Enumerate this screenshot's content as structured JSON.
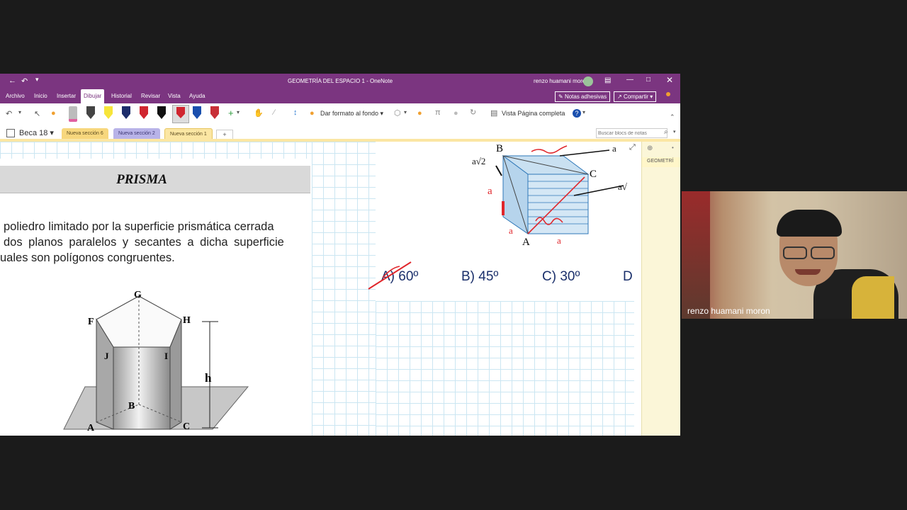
{
  "window": {
    "title": "GEOMETRÍA DEL ESPACIO 1  -  OneNote",
    "user": "renzo huamani moron"
  },
  "menu": {
    "tabs": [
      "Archivo",
      "Inicio",
      "Insertar",
      "Dibujar",
      "Historial",
      "Revisar",
      "Vista",
      "Ayuda"
    ],
    "sticky_notes": "Notas adhesivas",
    "share": "Compartir"
  },
  "ribbon": {
    "format_background": "Dar formato al fondo",
    "full_page_view": "Vista Página completa"
  },
  "notebook": {
    "name": "Beca 18",
    "sections": [
      "Nueva sección 6",
      "Nueva sección 2",
      "Nueva sección 1"
    ],
    "add_section": "+",
    "search_placeholder": "Buscar blocs de notas"
  },
  "pages_pane": {
    "page": "GEOMETRÍ"
  },
  "content": {
    "heading": "PRISMA",
    "definition_line1": "poliedro limitado por la superficie prismática cerrada",
    "definition_line2": "dos planos paralelos y secantes a dicha superficie",
    "definition_line3": "uales son polígonos congruentes.",
    "vertex_labels": [
      "G",
      "F",
      "H",
      "J",
      "I",
      "B",
      "A",
      "C",
      "h"
    ],
    "cube_labels": [
      "B",
      "C",
      "A"
    ],
    "options": [
      "A) 60º",
      "B) 45º",
      "C) 30º",
      "D"
    ]
  },
  "video": {
    "participant": "renzo huamani moron"
  },
  "colors": {
    "onenote_purple": "#7b3580",
    "grid_blue": "#cbe6f2",
    "ink_red": "#e0262b"
  }
}
